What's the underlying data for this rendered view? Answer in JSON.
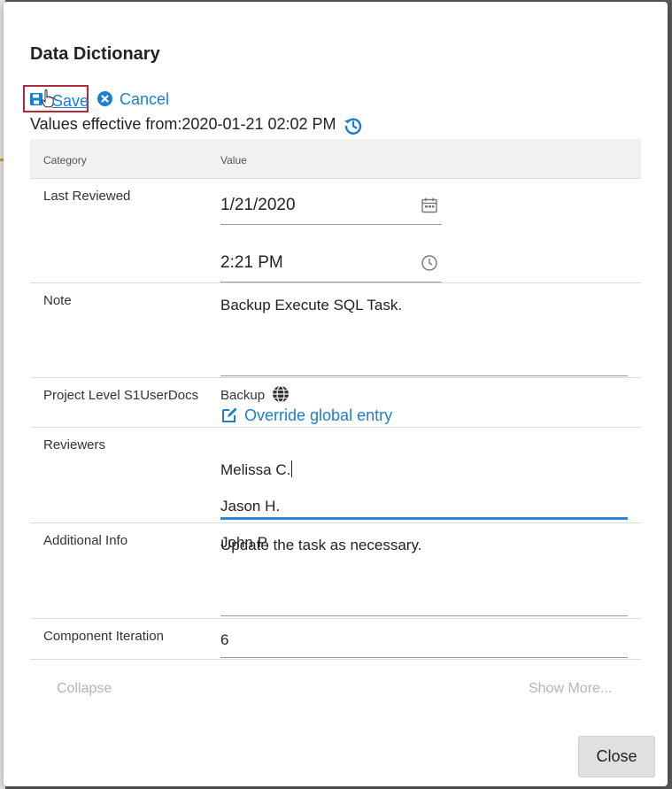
{
  "dialog": {
    "title": "Data Dictionary",
    "toolbar": {
      "save_label": "Save",
      "cancel_label": "Cancel"
    },
    "effective_text": "Values effective from:2020-01-21 02:02 PM",
    "table": {
      "headers": {
        "category": "Category",
        "value": "Value"
      },
      "rows": {
        "last_reviewed": {
          "category": "Last Reviewed",
          "date": "1/21/2020",
          "time": "2:21 PM"
        },
        "note": {
          "category": "Note",
          "value": "Backup Execute SQL Task."
        },
        "project_level": {
          "category": "Project Level S1UserDocs",
          "value": "Backup",
          "override_label": "Override global entry"
        },
        "reviewers": {
          "category": "Reviewers",
          "lines": [
            "Melissa C.",
            "Jason H.",
            "John P."
          ]
        },
        "additional_info": {
          "category": "Additional Info",
          "value": "Update the task as necessary."
        },
        "component_iteration": {
          "category": "Component Iteration",
          "value": "6"
        }
      }
    },
    "footer": {
      "collapse_label": "Collapse",
      "show_more_label": "Show More...",
      "close_label": "Close"
    }
  },
  "icons": {
    "save": "floppy-disk-icon",
    "cancel": "x-circle-icon",
    "history": "history-icon",
    "calendar": "calendar-icon",
    "clock": "clock-icon",
    "globe": "globe-icon",
    "edit": "edit-icon",
    "cursor": "hand-pointer-icon"
  },
  "colors": {
    "link": "#1b7fd1",
    "highlight_border": "#b0283a",
    "focus_line": "#2a85d6"
  }
}
